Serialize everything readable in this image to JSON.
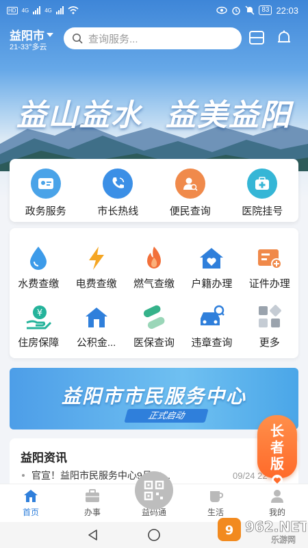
{
  "status_bar": {
    "network_labels": [
      "HD",
      "4G",
      "4G"
    ],
    "battery": "83",
    "time": "22:03"
  },
  "header": {
    "city": "益阳市",
    "weather": "21-33°多云",
    "search_placeholder": "查询服务..."
  },
  "hero": {
    "slogan_left": "益山益水",
    "slogan_right": "益美益阳"
  },
  "quick_services": [
    {
      "label": "政务服务",
      "icon": "id-card-icon",
      "color": "#4aa3e8"
    },
    {
      "label": "市长热线",
      "icon": "phone-icon",
      "color": "#3b8fe6"
    },
    {
      "label": "便民查询",
      "icon": "user-search-icon",
      "color": "#f08a4b"
    },
    {
      "label": "医院挂号",
      "icon": "medical-kit-icon",
      "color": "#35b6d6"
    }
  ],
  "grid_services": [
    {
      "label": "水费查缴",
      "icon": "water-drop-icon"
    },
    {
      "label": "电费查缴",
      "icon": "lightning-icon"
    },
    {
      "label": "燃气查缴",
      "icon": "flame-icon"
    },
    {
      "label": "户籍办理",
      "icon": "house-heart-icon"
    },
    {
      "label": "证件办理",
      "icon": "certificate-icon"
    },
    {
      "label": "住房保障",
      "icon": "yuan-hand-icon"
    },
    {
      "label": "公积金...",
      "icon": "home-icon"
    },
    {
      "label": "医保查询",
      "icon": "pill-icon"
    },
    {
      "label": "违章查询",
      "icon": "car-search-icon"
    },
    {
      "label": "更多",
      "icon": "more-grid-icon"
    }
  ],
  "banner": {
    "title": "益阳市市民服务中心",
    "subtitle": "正式启动"
  },
  "news": {
    "title": "益阳资讯",
    "items": [
      {
        "text": "官宣！益阳市民服务中心9月30...",
        "date": "09/24 22"
      }
    ]
  },
  "elder_mode": {
    "line1": "长",
    "line2": "者",
    "line3": "版"
  },
  "tabs": [
    {
      "label": "首页",
      "icon": "home-tab-icon",
      "active": true
    },
    {
      "label": "办事",
      "icon": "briefcase-icon",
      "active": false
    },
    {
      "label": "益码通",
      "icon": "qr-code-icon",
      "active": false
    },
    {
      "label": "生活",
      "icon": "cup-icon",
      "active": false
    },
    {
      "label": "我的",
      "icon": "person-icon",
      "active": false
    }
  ],
  "watermark": {
    "text": "962.NET",
    "sub": "乐游网"
  },
  "colors": {
    "accent": "#2f7fdb",
    "elder": "#ff7a35"
  }
}
